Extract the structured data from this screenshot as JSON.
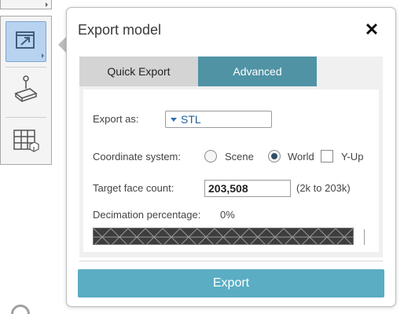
{
  "dialog": {
    "title": "Export model",
    "close_icon": "close-icon"
  },
  "tabs": [
    {
      "label": "Quick Export",
      "selected": false
    },
    {
      "label": "Advanced",
      "selected": true
    }
  ],
  "export_as": {
    "label": "Export as:",
    "value": "STL"
  },
  "coordinate_system": {
    "label": "Coordinate system:",
    "options": [
      {
        "label": "Scene",
        "selected": false
      },
      {
        "label": "World",
        "selected": true
      }
    ],
    "y_up": {
      "label": "Y-Up",
      "checked": false
    }
  },
  "target_face_count": {
    "label": "Target face count:",
    "value": "203,508",
    "range": "(2k to 203k)"
  },
  "decimation": {
    "label": "Decimation percentage:",
    "value": "0%"
  },
  "export_button": {
    "label": "Export"
  },
  "toolbar": {
    "items": [
      {
        "icon": "export-icon",
        "active": true
      },
      {
        "icon": "plane-cut-icon",
        "active": false
      },
      {
        "icon": "grid-table-icon",
        "active": false
      }
    ]
  },
  "colors": {
    "tab_active": "#4f93a4",
    "tab_inactive": "#d4d4d4",
    "export_button": "#5aadc3",
    "tool_active": "#b7d3ef",
    "dropdown_text": "#1f5f96"
  }
}
